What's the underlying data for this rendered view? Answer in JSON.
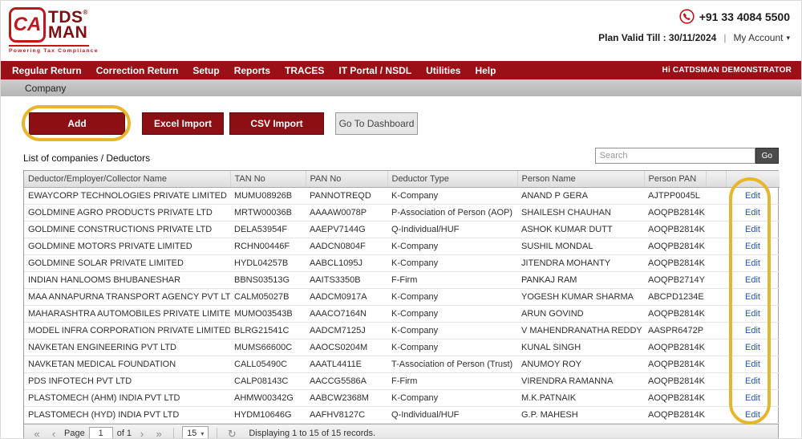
{
  "colors": {
    "brand": "#9b1016",
    "btn": "#8c1013",
    "annotation": "#e8b62c",
    "link": "#2457a7"
  },
  "icons": {
    "caret": "▾"
  },
  "header": {
    "logo": {
      "ca": "CA",
      "tds": "TDS",
      "man": "MAN",
      "reg": "®",
      "tagline": "Powering Tax Compliance"
    },
    "phone": "+91 33 4084 5500",
    "plan_valid": "Plan Valid Till : 30/11/2024",
    "divider": "|",
    "my_account": "My Account"
  },
  "nav": {
    "items": [
      "Regular Return",
      "Correction Return",
      "Setup",
      "Reports",
      "TRACES",
      "IT Portal / NSDL",
      "Utilities",
      "Help"
    ],
    "greeting": "Hi CATDSMAN DEMONSTRATOR"
  },
  "breadcrumb": "Company",
  "toolbar": {
    "add": "Add",
    "excel_import": "Excel Import",
    "csv_import": "CSV Import",
    "dashboard": "Go To Dashboard"
  },
  "list": {
    "title": "List of companies / Deductors",
    "search_placeholder": "Search",
    "go": "Go"
  },
  "table": {
    "headers": [
      "Deductor/Employer/Collector Name",
      "TAN No",
      "PAN No",
      "Deductor Type",
      "Person Name",
      "Person PAN"
    ],
    "edit_label": "Edit",
    "rows": [
      {
        "name": "EWAYCORP TECHNOLOGIES PRIVATE LIMITED",
        "tan": "MUMU08926B",
        "pan": "PANNOTREQD",
        "type": "K-Company",
        "person_name": "ANAND P GERA",
        "person_pan": "AJTPP0045L"
      },
      {
        "name": "GOLDMINE AGRO PRODUCTS PRIVATE LTD",
        "tan": "MRTW00036B",
        "pan": "AAAAW0078P",
        "type": "P-Association of Person (AOP)",
        "person_name": "SHAILESH CHAUHAN",
        "person_pan": "AOQPB2814K"
      },
      {
        "name": "GOLDMINE CONSTRUCTIONS PRIVATE LTD",
        "tan": "DELA53954F",
        "pan": "AAEPV7144G",
        "type": "Q-Individual/HUF",
        "person_name": "ASHOK KUMAR DUTT",
        "person_pan": "AOQPB2814K"
      },
      {
        "name": "GOLDMINE MOTORS PRIVATE LIMITED",
        "tan": "RCHN00446F",
        "pan": "AADCN0804F",
        "type": "K-Company",
        "person_name": "SUSHIL MONDAL",
        "person_pan": "AOQPB2814K"
      },
      {
        "name": "GOLDMINE SOLAR PRIVATE LIMITED",
        "tan": "HYDL04257B",
        "pan": "AABCL1095J",
        "type": "K-Company",
        "person_name": "JITENDRA MOHANTY",
        "person_pan": "AOQPB2814K"
      },
      {
        "name": "INDIAN HANLOOMS BHUBANESHAR",
        "tan": "BBNS03513G",
        "pan": "AAITS3350B",
        "type": "F-Firm",
        "person_name": "PANKAJ RAM",
        "person_pan": "AOQPB2714Y"
      },
      {
        "name": "MAA ANNAPURNA TRANSPORT AGENCY PVT LTD",
        "tan": "CALM05027B",
        "pan": "AADCM0917A",
        "type": "K-Company",
        "person_name": "YOGESH KUMAR SHARMA",
        "person_pan": "ABCPD1234E"
      },
      {
        "name": "MAHARASHTRA AUTOMOBILES PRIVATE LIMITED",
        "tan": "MUMO03543B",
        "pan": "AAACO7164N",
        "type": "K-Company",
        "person_name": "ARUN GOVIND",
        "person_pan": "AOQPB2814K"
      },
      {
        "name": "MODEL INFRA CORPORATION PRIVATE LIMITED",
        "tan": "BLRG21541C",
        "pan": "AADCM7125J",
        "type": "K-Company",
        "person_name": "V MAHENDRANATHA REDDY",
        "person_pan": "AASPR6472P"
      },
      {
        "name": "NAVKETAN ENGINEERING PVT LTD",
        "tan": "MUMS66600C",
        "pan": "AAOCS0204M",
        "type": "K-Company",
        "person_name": "KUNAL SINGH",
        "person_pan": "AOQPB2814K"
      },
      {
        "name": "NAVKETAN MEDICAL FOUNDATION",
        "tan": "CALL05490C",
        "pan": "AAATL4411E",
        "type": "T-Association of Person (Trust)",
        "person_name": "ANUMOY ROY",
        "person_pan": "AOQPB2814K"
      },
      {
        "name": "PDS INFOTECH PVT LTD",
        "tan": "CALP08143C",
        "pan": "AACCG5586A",
        "type": "F-Firm",
        "person_name": "VIRENDRA RAMANNA",
        "person_pan": "AOQPB2814K"
      },
      {
        "name": "PLASTOMECH (AHM) INDIA PVT LTD",
        "tan": "AHMW00342G",
        "pan": "AABCW2368M",
        "type": "K-Company",
        "person_name": "M.K.PATNAIK",
        "person_pan": "AOQPB2814K"
      },
      {
        "name": "PLASTOMECH (HYD) INDIA PVT LTD",
        "tan": "HYDM10646G",
        "pan": "AAFHV8127C",
        "type": "Q-Individual/HUF",
        "person_name": "G.P. MAHESH",
        "person_pan": "AOQPB2814K"
      }
    ]
  },
  "pagination": {
    "icons": {
      "first": "«",
      "prev": "‹",
      "next": "›",
      "last": "»",
      "refresh": "↻"
    },
    "page_label": "Page",
    "page_value": "1",
    "of_label": "of 1",
    "page_size": "15",
    "status": "Displaying 1 to 15 of 15 records."
  }
}
